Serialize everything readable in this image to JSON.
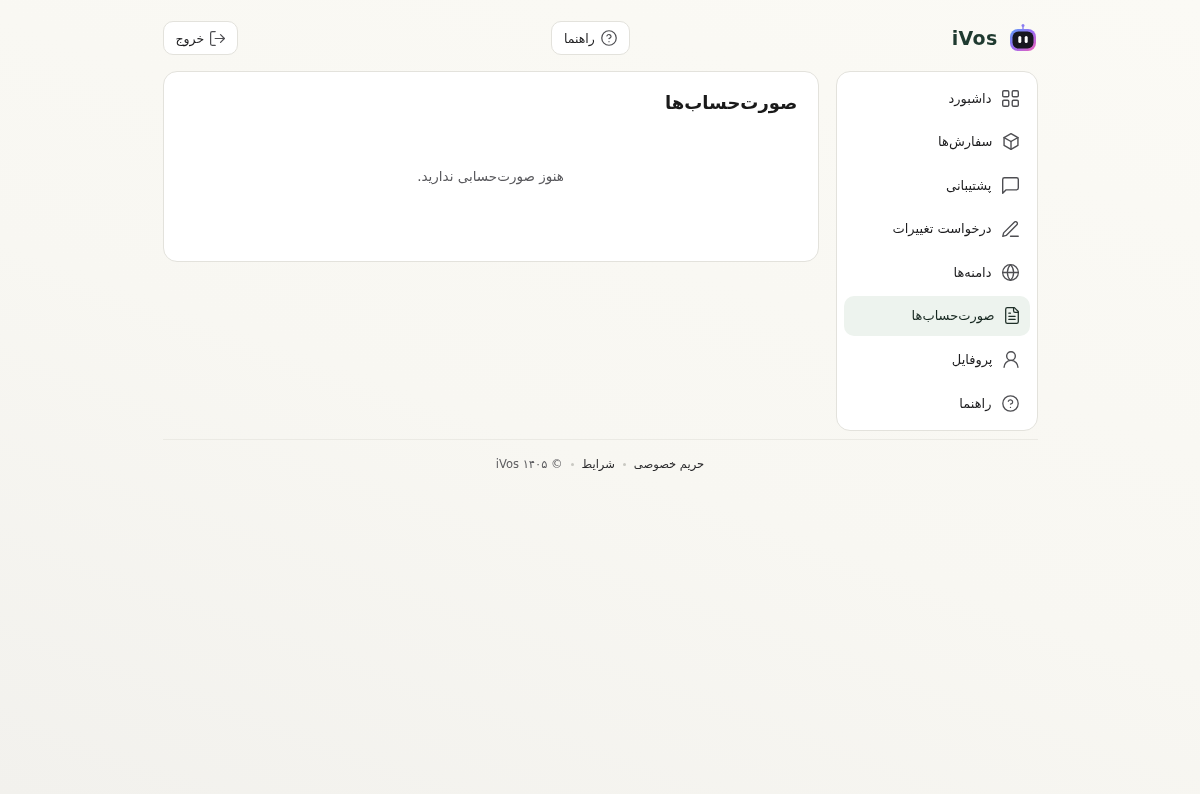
{
  "header": {
    "logo": {
      "text": "iVos"
    },
    "help_button": {
      "label": "راهنما"
    },
    "logout_button": {
      "label": "خروج"
    }
  },
  "sidebar": {
    "items": [
      {
        "kind": "dashboard",
        "label": "داشبورد",
        "selected": false
      },
      {
        "kind": "orders",
        "label": "سفارش‌ها",
        "selected": false
      },
      {
        "kind": "support",
        "label": "پشتیبانی",
        "selected": false
      },
      {
        "kind": "requests",
        "label": "درخواست تغییرات",
        "selected": false
      },
      {
        "kind": "domains",
        "label": "دامنه‌ها",
        "selected": false
      },
      {
        "kind": "invoices",
        "label": "صورت‌حساب‌ها",
        "selected": true
      },
      {
        "kind": "profile",
        "label": "پروفایل",
        "selected": false
      },
      {
        "kind": "help",
        "label": "راهنما",
        "selected": false
      }
    ]
  },
  "content": {
    "title": "صورت‌حساب‌ها",
    "empty_message": "هنوز صورت‌حسابی ندارید."
  },
  "footer": {
    "links": [
      {
        "label": "حریم خصوصی"
      },
      {
        "label": "شرایط"
      }
    ],
    "copyright": "© ۱۴۰۵ iVos"
  }
}
